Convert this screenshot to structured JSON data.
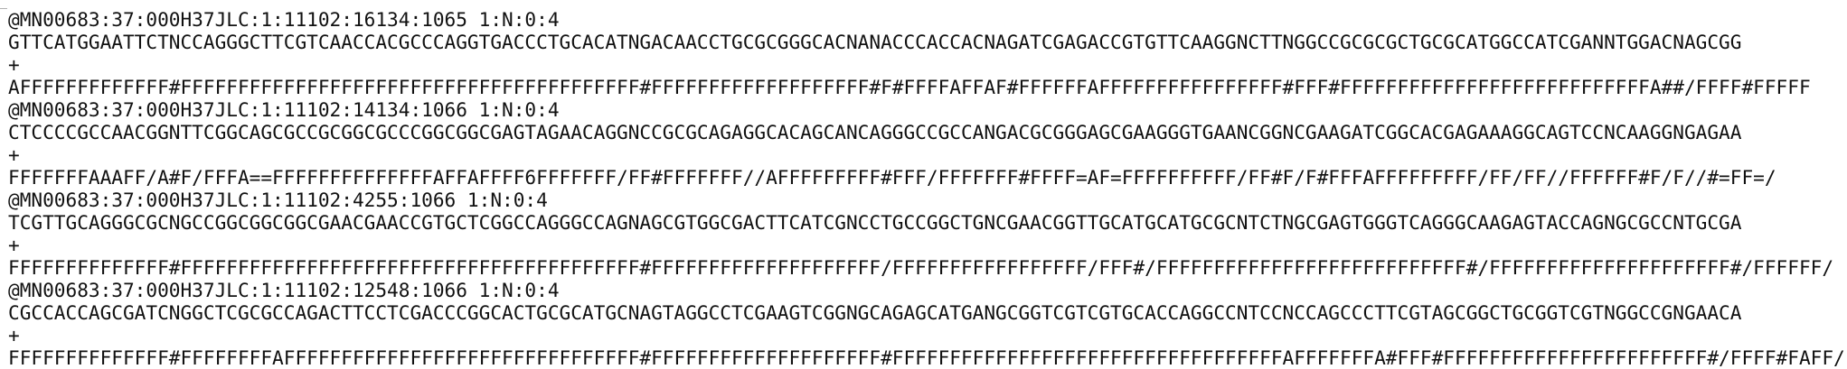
{
  "records": [
    {
      "header": "@MN00683:37:000H37JLC:1:11102:16134:1065 1:N:0:4",
      "sequence": "GTTCATGGAATTCTNCCAGGGCTTCGTCAACCACGCCCAGGTGACCCTGCACATNGACAACCTGCGCGGGCACNANACCCACCACNAGATCGAGACCGTGTTCAAGGNCTTNGGCCGCGCGCTGCGCATGGCCATCGANNTGGACNAGCGG",
      "separator": "+",
      "quality": "AFFFFFFFFFFFFF#FFFFFFFFFFFFFFFFFFFFFFFFFFFFFFFFFFFFFFFF#FFFFFFFFFFFFFFFFFFF#F#FFFFAFFAF#FFFFFFAFFFFFFFFFFFFFFFF#FFF#FFFFFFFFFFFFFFFFFFFFFFFFFFFA##/FFFF#FFFFF"
    },
    {
      "header": "@MN00683:37:000H37JLC:1:11102:14134:1066 1:N:0:4",
      "sequence": "CTCCCCGCCAACGGNTTCGGCAGCGCCGCGGCGCCCGGCGGCGAGTAGAACAGGNCCGCGCAGAGGCACAGCANCAGGGCCGCCANGACGCGGGAGCGAAGGGTGAANCGGNCGAAGATCGGCACGAGAAAGGCAGTCCNCAAGGNGAGAA",
      "separator": "+",
      "quality": "FFFFFFFAAAFF/A#F/FFFA==FFFFFFFFFFFFFFAFFAFFFF6FFFFFFF/FF#FFFFFFF//AFFFFFFFFF#FFF/FFFFFFF#FFFF=AF=FFFFFFFFFF/FF#F/F#FFFAFFFFFFFFF/FF/FF//FFFFFF#F/F//#=FF=/"
    },
    {
      "header": "@MN00683:37:000H37JLC:1:11102:4255:1066 1:N:0:4",
      "sequence": "TCGTTGCAGGGCGCNGCCGGCGGCGGCGAACGAACCGTGCTCGGCCAGGGCCAGNAGCGTGGCGACTTCATCGNCCTGCCGGCTGNCGAACGGTTGCATGCATGCGCNTCTNGCGAGTGGGTCAGGGCAAGAGTACCAGNGCGCCNTGCGA",
      "separator": "+",
      "quality": "FFFFFFFFFFFFFF#FFFFFFFFFFFFFFFFFFFFFFFFFFFFFFFFFFFFFFFF#FFFFFFFFFFFFFFFFFFFF/FFFFFFFFFFFFFFFFF/FFF#/FFFFFFFFFFFFFFFFFFFFFFFFFFF#/FFFFFFFFFFFFFFFFFFFFF#/FFFFFF/"
    },
    {
      "header": "@MN00683:37:000H37JLC:1:11102:12548:1066 1:N:0:4",
      "sequence": "CGCCACCAGCGATCNGGCTCGCGCCAGACTTCCTCGACCCGGCACTGCGCATGCNAGTAGGCCTCGAAGTCGGNGCAGAGCATGANGCGGTCGTCGTGCACCAGGCCNTCCNCCAGCCCTTCGTAGCGGCTGCGGTCGTNGGCCGNGAACA",
      "separator": "+",
      "quality": "FFFFFFFFFFFFFF#FFFFFFFFAFFFFFFFFFFFFFFFFFFFFFFFFFFFFFFF#FFFFFFFFFFFFFFFFFFFF#FFFFFFFFFFFFFFFFFFFFFFFFFFFFFFFFFFAFFFFFFFA#FFF#FFFFFFFFFFFFFFFFFFFFFFF#/FFFF#FAFF/"
    }
  ]
}
